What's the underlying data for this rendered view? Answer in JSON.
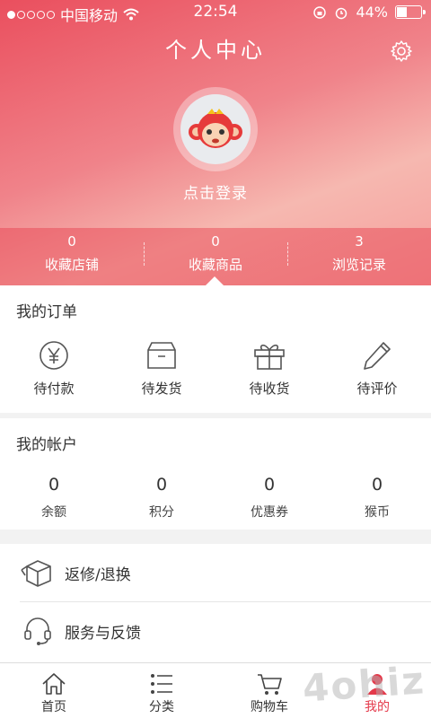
{
  "status_bar": {
    "carrier": "中国移动",
    "time": "22:54",
    "battery": "44%",
    "battery_level": 0.44
  },
  "header": {
    "title": "个人中心",
    "login_text": "点击登录"
  },
  "stats": [
    {
      "value": "0",
      "label": "收藏店铺"
    },
    {
      "value": "0",
      "label": "收藏商品"
    },
    {
      "value": "3",
      "label": "浏览记录"
    }
  ],
  "orders": {
    "title": "我的订单",
    "items": [
      {
        "label": "待付款",
        "icon": "yen-icon"
      },
      {
        "label": "待发货",
        "icon": "box-icon"
      },
      {
        "label": "待收货",
        "icon": "gift-icon"
      },
      {
        "label": "待评价",
        "icon": "pencil-icon"
      }
    ]
  },
  "account": {
    "title": "我的帐户",
    "items": [
      {
        "value": "0",
        "label": "余额"
      },
      {
        "value": "0",
        "label": "积分"
      },
      {
        "value": "0",
        "label": "优惠券"
      },
      {
        "value": "0",
        "label": "猴币"
      }
    ]
  },
  "menu": [
    {
      "label": "返修/退换",
      "icon": "return-box-icon"
    },
    {
      "label": "服务与反馈",
      "icon": "headset-icon"
    }
  ],
  "tabbar": [
    {
      "label": "首页",
      "icon": "home-icon"
    },
    {
      "label": "分类",
      "icon": "list-icon"
    },
    {
      "label": "购物车",
      "icon": "cart-icon"
    },
    {
      "label": "我的",
      "icon": "user-icon",
      "active": true
    }
  ],
  "watermark": "4ohiz",
  "colors": {
    "accent": "#e4394a",
    "header_start": "#ea4f5e",
    "header_end": "#f6b8b0"
  }
}
